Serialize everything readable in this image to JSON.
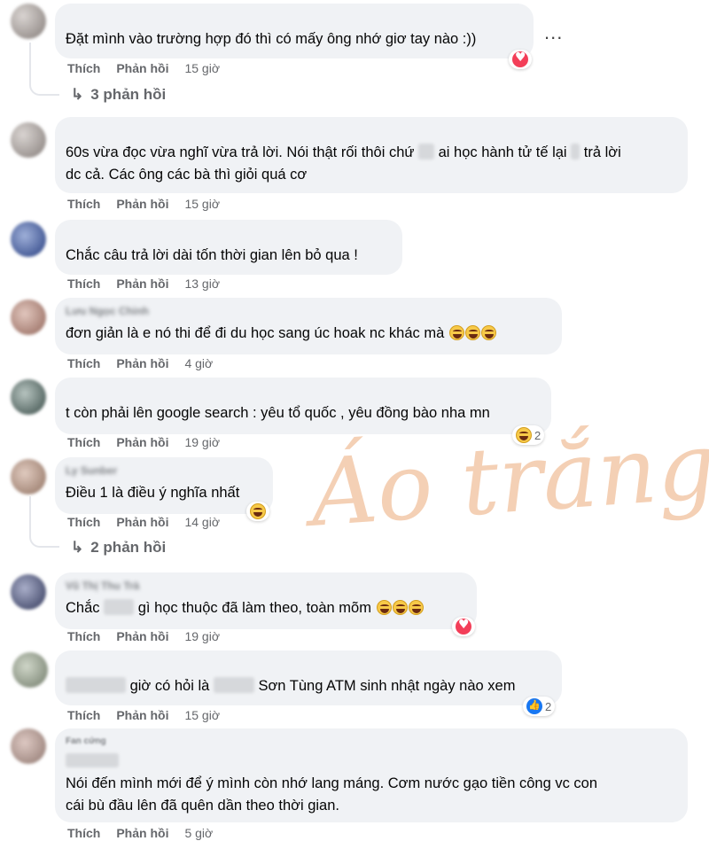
{
  "actions": {
    "like": "Thích",
    "reply": "Phản hồi"
  },
  "more_menu": "...",
  "watermark": "Áo trắng",
  "comments": [
    {
      "author": "",
      "text": "Đặt mình vào trường hợp đó thì có mấy ông nhớ giơ tay nào :))",
      "time": "15 giờ",
      "reaction": {
        "types": [
          "love"
        ],
        "count": ""
      },
      "replies": "3 phản hồi"
    },
    {
      "author": "",
      "text_line1_a": "60s vừa đọc vừa nghĩ vừa trả lời. Nói thật rối thôi chứ",
      "text_line1_b": "ai học hành tử tế lại",
      "text_line1_c": "trả lời",
      "text_line2": "dc cả. Các ông các bà thì giỏi quá cơ",
      "time": "15 giờ"
    },
    {
      "author": "",
      "text": "Chắc câu trả lời dài tốn thời gian lên bỏ qua !",
      "time": "13 giờ"
    },
    {
      "author": "Lưu Ngọc Chinh",
      "text": "đơn giản là e nó thi để đi du học sang úc hoak nc khác mà",
      "time": "4 giờ"
    },
    {
      "author": "",
      "text": "t còn phải lên google search : yêu tổ quốc , yêu đồng bào nha mn",
      "time": "19 giờ",
      "reaction": {
        "types": [
          "haha"
        ],
        "count": "2"
      }
    },
    {
      "author": "Ly Sunber",
      "text": "Điều 1 là điều ý nghĩa nhất",
      "time": "14 giờ",
      "reaction": {
        "types": [
          "haha"
        ],
        "count": ""
      },
      "replies": "2 phản hồi"
    },
    {
      "author": "Vũ Thị Thu Trà",
      "text_a": "Chắc",
      "text_b": "gì học thuộc đã làm theo, toàn mõm",
      "time": "19 giờ",
      "reaction": {
        "types": [
          "love"
        ],
        "count": ""
      }
    },
    {
      "author": "",
      "text_a": "giờ có hỏi là",
      "text_b": "Sơn Tùng ATM sinh nhật ngày nào xem",
      "time": "15 giờ",
      "reaction": {
        "types": [
          "like"
        ],
        "count": "2"
      }
    },
    {
      "author": "Fan cứng",
      "text_line1": "Nói đến mình mới để ý mình còn nhớ lang máng. Cơm nước gạo tiền công vc con",
      "text_line2": "cái bù đầu lên đã quên dần theo thời gian.",
      "time": "5 giờ"
    }
  ]
}
